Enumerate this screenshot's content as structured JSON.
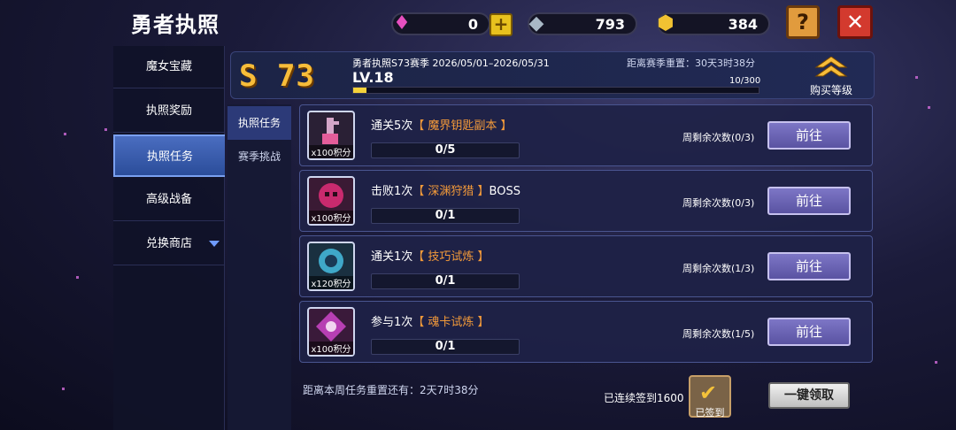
{
  "header": {
    "title": "勇者执照",
    "gems": "0",
    "crystals": "793",
    "coins": "384",
    "plus_label": "+",
    "help_label": "?",
    "close_label": "✕"
  },
  "sidebar": {
    "items": [
      {
        "label": "魔女宝藏"
      },
      {
        "label": "执照奖励"
      },
      {
        "label": "执照任务"
      },
      {
        "label": "高级战备"
      },
      {
        "label": "兑换商店"
      }
    ]
  },
  "subtabs": [
    {
      "label": "执照任务"
    },
    {
      "label": "赛季挑战"
    }
  ],
  "season": {
    "badge": "S 73",
    "title": "勇者执照S73赛季 2026/05/01–2026/05/31",
    "reset": "距离赛季重置：30天3时38分",
    "level": "LV.18",
    "xp_text": "10/300",
    "xp_fraction": 0.033,
    "buy_label": "购买等级"
  },
  "tasks": [
    {
      "title_prefix": "通关5次",
      "title_hl": "【 魔界钥匙副本 】",
      "title_suffix": "",
      "points": "x100积分",
      "progress": "0/5",
      "remain": "周剩余次数(0/3)",
      "go": "前往"
    },
    {
      "title_prefix": "击败1次",
      "title_hl": "【 深渊狩猎 】",
      "title_suffix": "BOSS",
      "points": "x100积分",
      "progress": "0/1",
      "remain": "周剩余次数(0/3)",
      "go": "前往"
    },
    {
      "title_prefix": "通关1次",
      "title_hl": "【 技巧试炼 】",
      "title_suffix": "",
      "points": "x120积分",
      "progress": "0/1",
      "remain": "周剩余次数(1/3)",
      "go": "前往"
    },
    {
      "title_prefix": "参与1次",
      "title_hl": "【 魂卡试炼 】",
      "title_suffix": "",
      "points": "x100积分",
      "progress": "0/1",
      "remain": "周剩余次数(1/5)",
      "go": "前往"
    }
  ],
  "footer": {
    "weekly_reset": "距离本周任务重置还有：2天7时38分",
    "signin_text": "已连续签到1600",
    "signed_label": "已签到",
    "claim_all": "一键领取"
  },
  "colors": {
    "accent_gold": "#f7bd3a",
    "highlight_orange": "#f39a3a",
    "go_button": "#6a63b4",
    "close_red": "#d33a2e"
  }
}
